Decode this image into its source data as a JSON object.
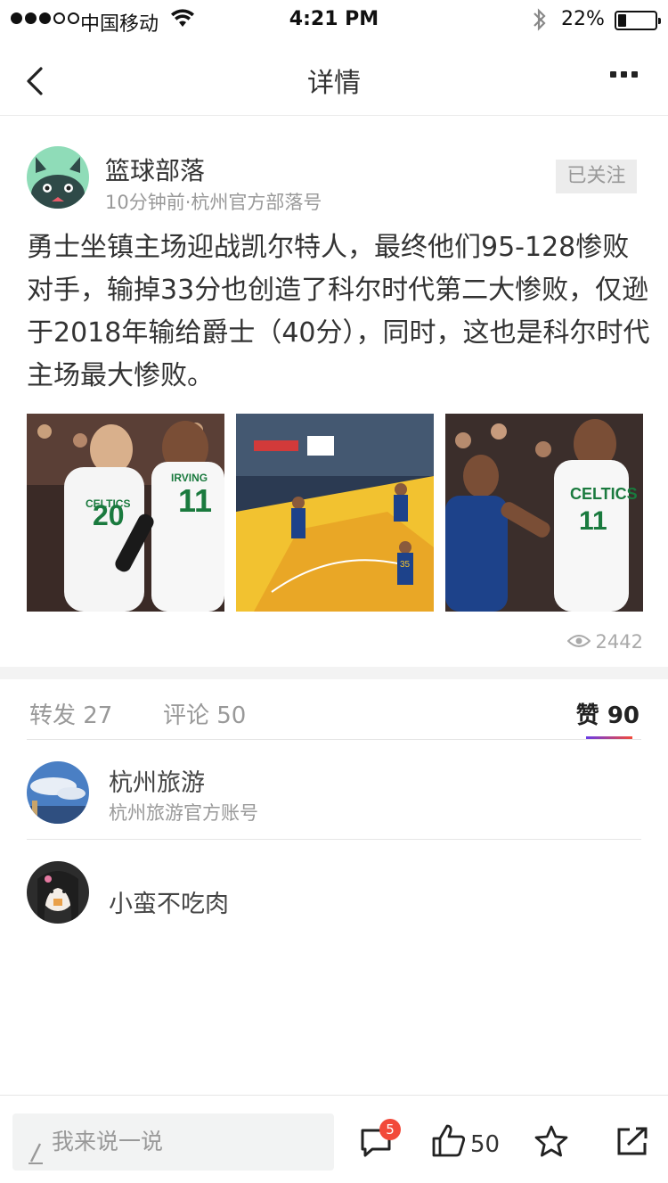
{
  "status_bar": {
    "carrier": "中国移动",
    "time": "4:21 PM",
    "battery_percent": "22%",
    "battery_level": 0.22
  },
  "nav": {
    "title": "详情"
  },
  "post": {
    "author": "篮球部落",
    "meta": "10分钟前·杭州官方部落号",
    "follow_label": "已关注",
    "content": "勇士坐镇主场迎战凯尔特人，最终他们95-128惨败对手，输掉33分也创造了科尔时代第二大惨败，仅逊于2018年输给爵士（40分），同时，这也是科尔时代主场最大惨败。",
    "image_jerseys": {
      "img1_player1": "20",
      "img1_player2": "11",
      "img1_name": "IRVING",
      "img1_team": "CELTICS",
      "img2_number": "35",
      "img3_team": "CELTICS",
      "img3_number": "11"
    },
    "view_count": "2442"
  },
  "tabs": {
    "repost": "转发 27",
    "comment": "评论 50",
    "like": "赞 90"
  },
  "likers": [
    {
      "name": "杭州旅游",
      "subtitle": "杭州旅游官方账号"
    },
    {
      "name": "小蛮不吃肉",
      "subtitle": ""
    }
  ],
  "bottom_bar": {
    "comment_placeholder": "我来说一说",
    "comment_badge": "5",
    "like_count": "50"
  },
  "colors": {
    "accent_gradient_start": "#6a3ce6",
    "accent_gradient_end": "#f24a3a",
    "badge": "#f24a3a",
    "celtics_green": "#1a7a3e",
    "warriors_blue": "#1d428a",
    "court_yellow": "#f2c230"
  }
}
